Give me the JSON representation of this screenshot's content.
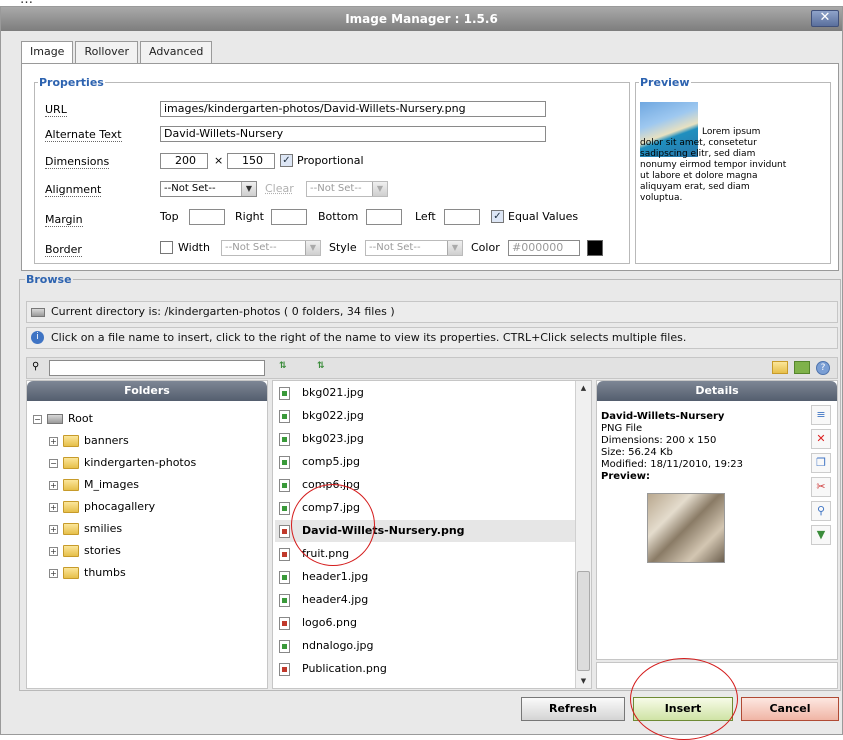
{
  "window": {
    "title": "Image Manager : 1.5.6",
    "close_label": "✕"
  },
  "tabs": [
    {
      "label": "Image"
    },
    {
      "label": "Rollover"
    },
    {
      "label": "Advanced"
    }
  ],
  "properties": {
    "legend": "Properties",
    "url_label": "URL",
    "url_value": "images/kindergarten-photos/David-Willets-Nursery.png",
    "alt_label": "Alternate Text",
    "alt_value": "David-Willets-Nursery",
    "dimensions_label": "Dimensions",
    "width_value": "200",
    "times": "×",
    "height_value": "150",
    "proportional_label": "Proportional",
    "alignment_label": "Alignment",
    "alignment_value": "--Not Set--",
    "clear_label": "Clear",
    "clear_value": "--Not Set--",
    "margin_label": "Margin",
    "margin_top": "Top",
    "margin_right": "Right",
    "margin_bottom": "Bottom",
    "margin_left": "Left",
    "equal_values_label": "Equal Values",
    "border_label": "Border",
    "border_width_label": "Width",
    "border_width_value": "--Not Set--",
    "border_style_label": "Style",
    "border_style_value": "--Not Set--",
    "border_color_label": "Color",
    "border_color_value": "#000000"
  },
  "preview": {
    "legend": "Preview",
    "lines": [
      "Lorem ipsum",
      "dolor sit amet, consetetur",
      "sadipscing elitr, sed diam",
      "nonumy eirmod tempor invidunt",
      "ut labore et dolore magna",
      "aliquyam erat, sed diam",
      "voluptua."
    ]
  },
  "browse": {
    "legend": "Browse",
    "current_dir": "Current directory is: /kindergarten-photos ( 0 folders, 34 files )",
    "info": "Click on a file name to insert, click to the right of the name to view its properties. CTRL+Click selects multiple files.",
    "sort_icon_a": "⇅",
    "sort_icon_b": "⇅"
  },
  "folders": {
    "title": "Folders",
    "root": "Root",
    "items": [
      "banners",
      "kindergarten-photos",
      "M_images",
      "phocagallery",
      "smilies",
      "stories",
      "thumbs"
    ]
  },
  "files": {
    "items": [
      {
        "name": "bkg021.jpg",
        "type": "jpg"
      },
      {
        "name": "bkg022.jpg",
        "type": "jpg"
      },
      {
        "name": "bkg023.jpg",
        "type": "jpg"
      },
      {
        "name": "comp5.jpg",
        "type": "jpg"
      },
      {
        "name": "comp6.jpg",
        "type": "jpg"
      },
      {
        "name": "comp7.jpg",
        "type": "jpg"
      },
      {
        "name": "David-Willets-Nursery.png",
        "type": "png",
        "selected": true
      },
      {
        "name": "fruit.png",
        "type": "png"
      },
      {
        "name": "header1.jpg",
        "type": "jpg"
      },
      {
        "name": "header4.jpg",
        "type": "jpg"
      },
      {
        "name": "logo6.png",
        "type": "png"
      },
      {
        "name": "ndnalogo.jpg",
        "type": "jpg"
      },
      {
        "name": "Publication.png",
        "type": "png"
      }
    ]
  },
  "details": {
    "title": "Details",
    "name": "David-Willets-Nursery",
    "type": "PNG File",
    "dimensions": "Dimensions: 200 x 150",
    "size": "Size: 56.24 Kb",
    "modified": "Modified: 18/11/2010, 19:23",
    "preview_label": "Preview:"
  },
  "buttons": {
    "refresh": "Refresh",
    "insert": "Insert",
    "cancel": "Cancel"
  },
  "colors": {
    "accent": "#2d63b0",
    "annotation": "#d41c1c"
  }
}
